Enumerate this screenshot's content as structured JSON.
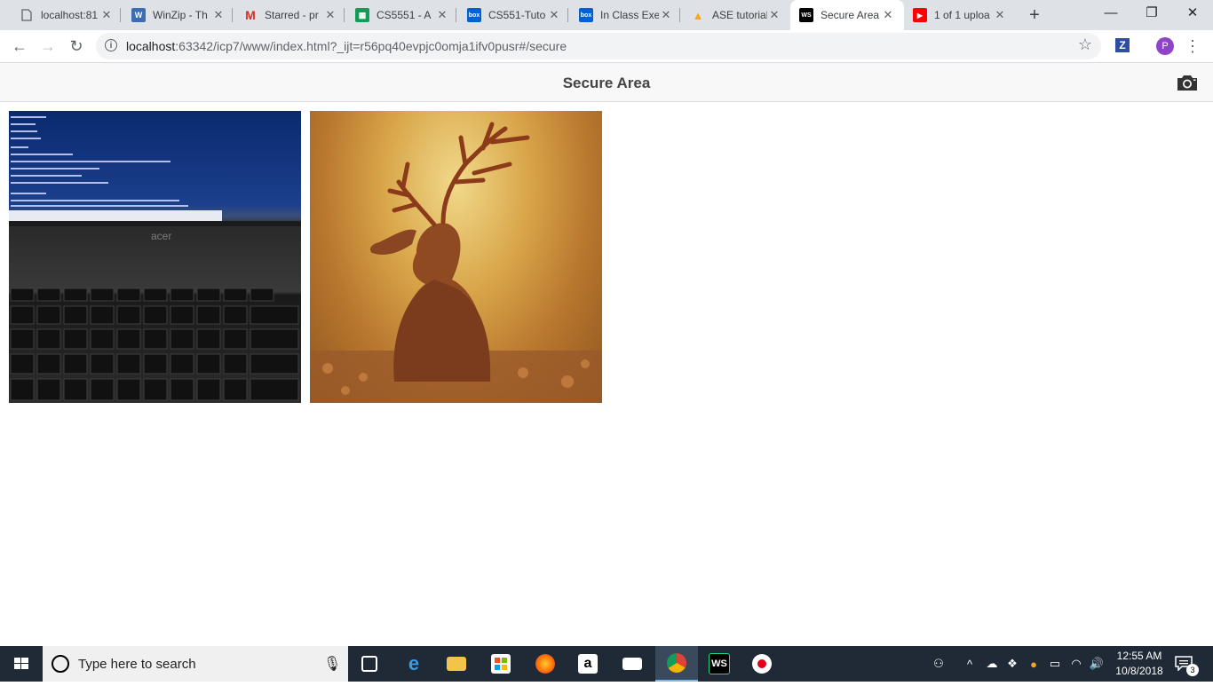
{
  "browser": {
    "tabs": [
      {
        "label": "localhost:81",
        "icon": "document-icon",
        "color": "#5f6368",
        "glyph": ""
      },
      {
        "label": "WinZip - Th",
        "icon": "winzip-icon",
        "color": "#3b6db3",
        "glyph": "W"
      },
      {
        "label": "Starred - pr",
        "icon": "gmail-icon",
        "color": "#d93025",
        "glyph": "M"
      },
      {
        "label": "CS5551 - A",
        "icon": "sheets-icon",
        "color": "#0f9d58",
        "glyph": "▦"
      },
      {
        "label": "CS551-Tuto",
        "icon": "box-icon",
        "color": "#0061d5",
        "glyph": "box"
      },
      {
        "label": "In Class Exe",
        "icon": "box-icon",
        "color": "#0061d5",
        "glyph": "box"
      },
      {
        "label": "ASE tutorial",
        "icon": "firebase-icon",
        "color": "#f6a623",
        "glyph": "▲"
      },
      {
        "label": "Secure Area",
        "icon": "webstorm-icon",
        "color": "#000000",
        "glyph": "WS"
      },
      {
        "label": "1 of 1 uploa",
        "icon": "youtube-icon",
        "color": "#ff0000",
        "glyph": "▶"
      }
    ],
    "url_host": "localhost",
    "url_rest": ":63342/icp7/www/index.html?_ijt=r56pq40evpjc0omja1ifv0pusr#/secure",
    "profile_initial": "P",
    "extension_letter": "Z"
  },
  "app": {
    "title": "Secure Area",
    "photos": [
      {
        "label": "laptop-keyboard-photo"
      },
      {
        "label": "deer-figurine-photo"
      }
    ]
  },
  "taskbar": {
    "search_placeholder": "Type here to search",
    "time": "12:55 AM",
    "date": "10/8/2018",
    "notification_count": "3"
  }
}
